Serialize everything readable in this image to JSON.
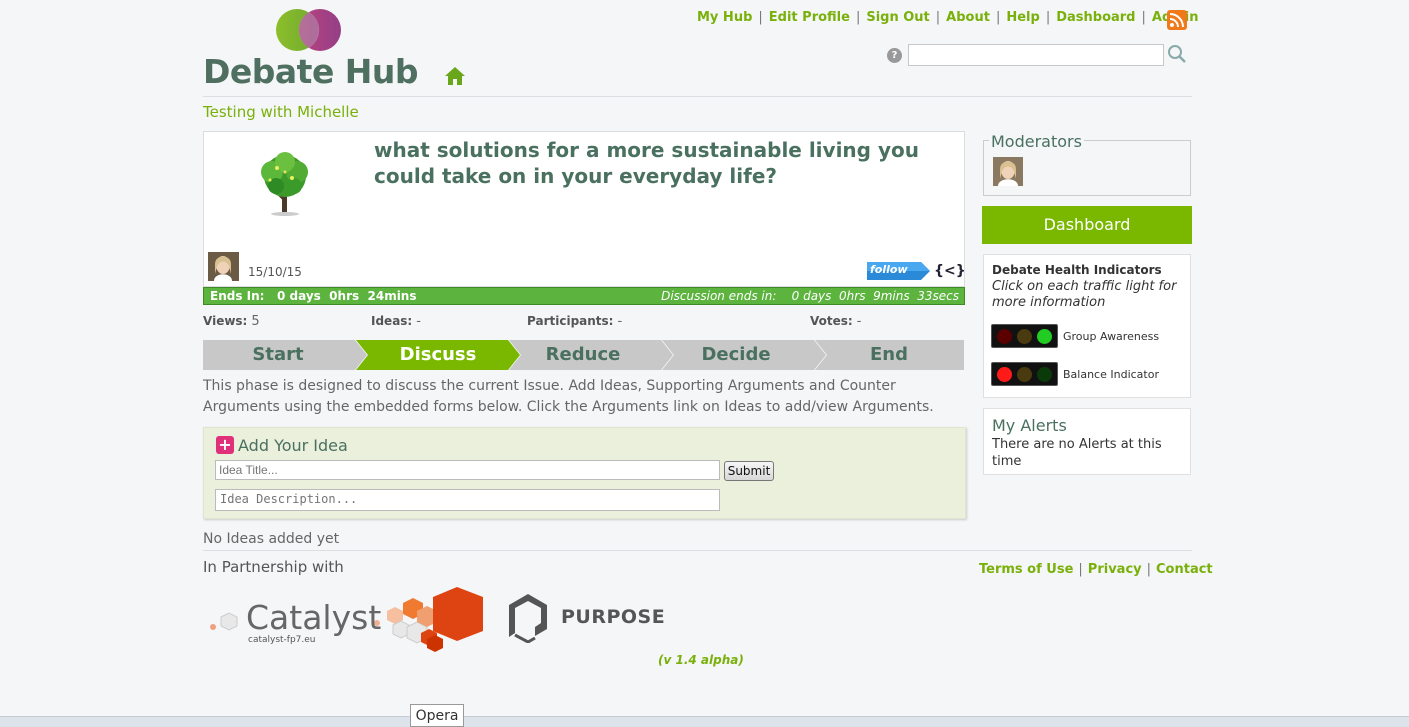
{
  "header": {
    "logo_text": "Debate Hub",
    "nav": [
      "My Hub",
      "Edit Profile",
      "Sign Out",
      "About",
      "Help",
      "Dashboard",
      "Admin"
    ],
    "help_glyph": "?",
    "search_placeholder": ""
  },
  "group_title": "Testing with Michelle",
  "issue": {
    "title": "what solutions for a more sustainable living you could take on in your everyday life?",
    "date": "15/10/15",
    "follow_label": "follow",
    "embed_glyph": "{<}"
  },
  "countdown": {
    "left_label": "Ends In:",
    "left_value": "0 days  0hrs  24mins",
    "right_label": "Discussion ends in:",
    "right_value": "0 days  0hrs  9mins  33secs"
  },
  "stats": [
    {
      "label": "Views:",
      "value": "5"
    },
    {
      "label": "Ideas:",
      "value": "-"
    },
    {
      "label": "Participants:",
      "value": "-"
    },
    {
      "label": "Votes:",
      "value": "-"
    }
  ],
  "phases": [
    "Start",
    "Discuss",
    "Reduce",
    "Decide",
    "End"
  ],
  "active_phase": "Discuss",
  "phase_description": "This phase is designed to discuss the current Issue. Add Ideas, Supporting Arguments and Counter Arguments using the embedded forms below. Click the Arguments link on Ideas to add/view Arguments.",
  "add_idea": {
    "heading": "Add Your Idea",
    "plus_glyph": "+",
    "title_placeholder": "Idea Title...",
    "description_placeholder": "Idea Description...",
    "submit_label": "Submit"
  },
  "no_ideas_text": "No Ideas added yet",
  "sidebar": {
    "moderators_title": "Moderators",
    "dashboard_label": "Dashboard",
    "health_title": "Debate Health Indicators",
    "health_subtitle": "Click on each traffic light for more information",
    "indicators": [
      {
        "label": "Group Awareness",
        "state": "green"
      },
      {
        "label": "Balance Indicator",
        "state": "red"
      }
    ],
    "alerts_title": "My Alerts",
    "alerts_text": "There are no Alerts at this time"
  },
  "footer": {
    "partnership_label": "In Partnership with",
    "links": [
      "Terms of Use",
      "Privacy",
      "Contact"
    ],
    "catalyst_name": "Catalyst",
    "catalyst_url": "catalyst-fp7.eu",
    "purpose_name": "PURPOSE",
    "version": "(v 1.4 alpha)"
  },
  "browser": {
    "tab_label": "Opera"
  },
  "colors": {
    "brand_green": "#7ab800",
    "title_green": "#4a7060",
    "countdown_green": "#5cb33e",
    "phase_inactive": "#c8c8c8",
    "catalyst_orange": "#dd4411",
    "plus_pink": "#e0307a"
  }
}
